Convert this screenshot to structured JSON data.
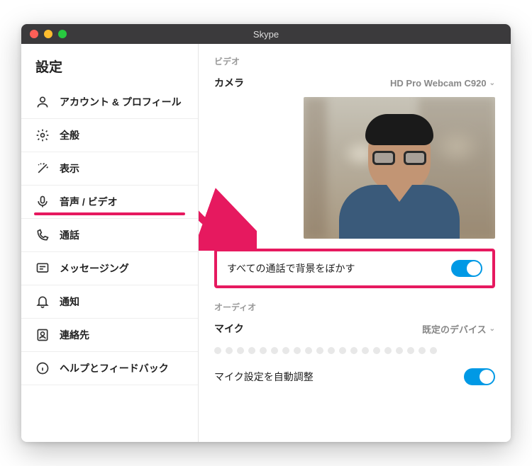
{
  "window": {
    "title": "Skype"
  },
  "sidebar": {
    "title": "設定",
    "items": [
      {
        "label": "アカウント & プロフィール"
      },
      {
        "label": "全般"
      },
      {
        "label": "表示"
      },
      {
        "label": "音声 / ビデオ"
      },
      {
        "label": "通話"
      },
      {
        "label": "メッセージング"
      },
      {
        "label": "通知"
      },
      {
        "label": "連絡先"
      },
      {
        "label": "ヘルプとフィードバック"
      }
    ]
  },
  "main": {
    "video": {
      "section_label": "ビデオ",
      "camera_label": "カメラ",
      "camera_device": "HD Pro Webcam C920",
      "blur_label": "すべての通話で背景をぼかす",
      "blur_enabled": true
    },
    "audio": {
      "section_label": "オーディオ",
      "mic_label": "マイク",
      "mic_device": "既定のデバイス",
      "auto_adjust_label": "マイク設定を自動調整",
      "auto_adjust_enabled": true
    }
  },
  "annotations": {
    "highlight_color": "#e6195f"
  }
}
